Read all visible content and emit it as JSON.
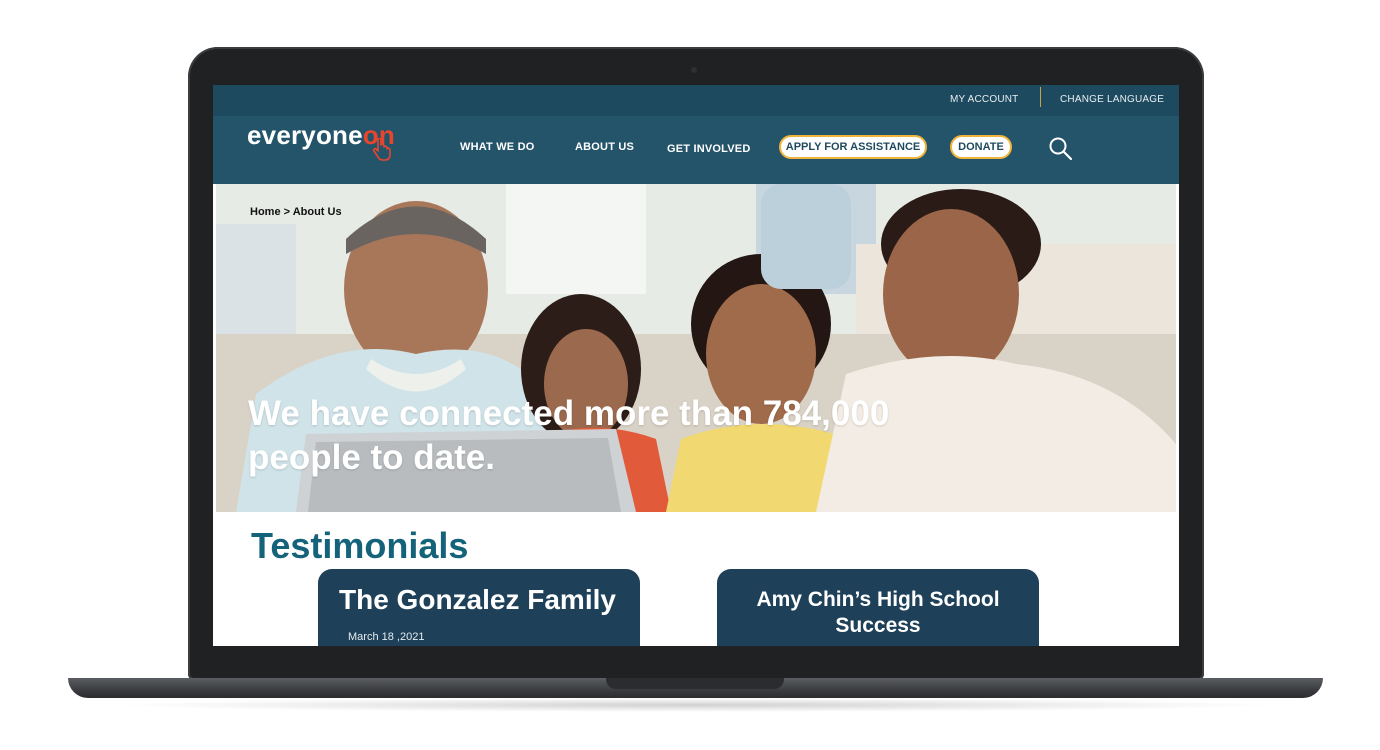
{
  "topbar": {
    "my_account": "MY ACCOUNT",
    "change_language": "CHANGE LANGUAGE"
  },
  "logo": {
    "main": "everyone",
    "accent": "on"
  },
  "nav": {
    "what_we_do": "WHAT WE DO",
    "about_us": "ABOUT US",
    "get_involved": "GET INVOLVED",
    "apply": "APPLY FOR ASSISTANCE",
    "donate": "DONATE"
  },
  "icons": {
    "search": "search-icon",
    "cursor": "pointer-hand-icon"
  },
  "hero": {
    "breadcrumb": "Home > About Us",
    "headline": "We have connected more than 784,000 people to date."
  },
  "testimonials": {
    "heading": "Testimonials",
    "cards": [
      {
        "title": "The Gonzalez Family",
        "date": "March 18 ,2021"
      },
      {
        "title": "Amy Chin’s High School Success"
      }
    ]
  },
  "colors": {
    "topbar": "#1e4a5f",
    "navbar": "#24546a",
    "accent_orange": "#f0b43a",
    "logo_red": "#e8452c",
    "heading_teal": "#15637a",
    "card_navy": "#1e4058"
  }
}
